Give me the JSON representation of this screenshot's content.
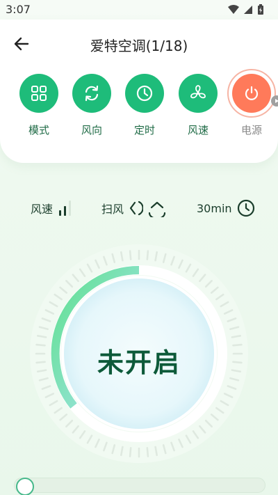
{
  "status_bar": {
    "time": "3:07"
  },
  "header": {
    "title": "爱特空调(1/18)"
  },
  "controls": [
    {
      "id": "mode",
      "label": "模式",
      "icon": "grid-icon"
    },
    {
      "id": "wind-direction",
      "label": "风向",
      "icon": "refresh-icon"
    },
    {
      "id": "timer",
      "label": "定时",
      "icon": "clock-icon"
    },
    {
      "id": "fan-speed",
      "label": "风速",
      "icon": "fan-icon"
    },
    {
      "id": "power",
      "label": "电源",
      "icon": "power-icon"
    }
  ],
  "status_info": {
    "fan_speed_label": "风速",
    "swing_label": "扫风",
    "timer_value": "30min"
  },
  "dial": {
    "state_text": "未开启"
  },
  "colors": {
    "primary": "#1ebc7a",
    "power": "#ff7a5a",
    "text_dark_green": "#0d5a39"
  }
}
